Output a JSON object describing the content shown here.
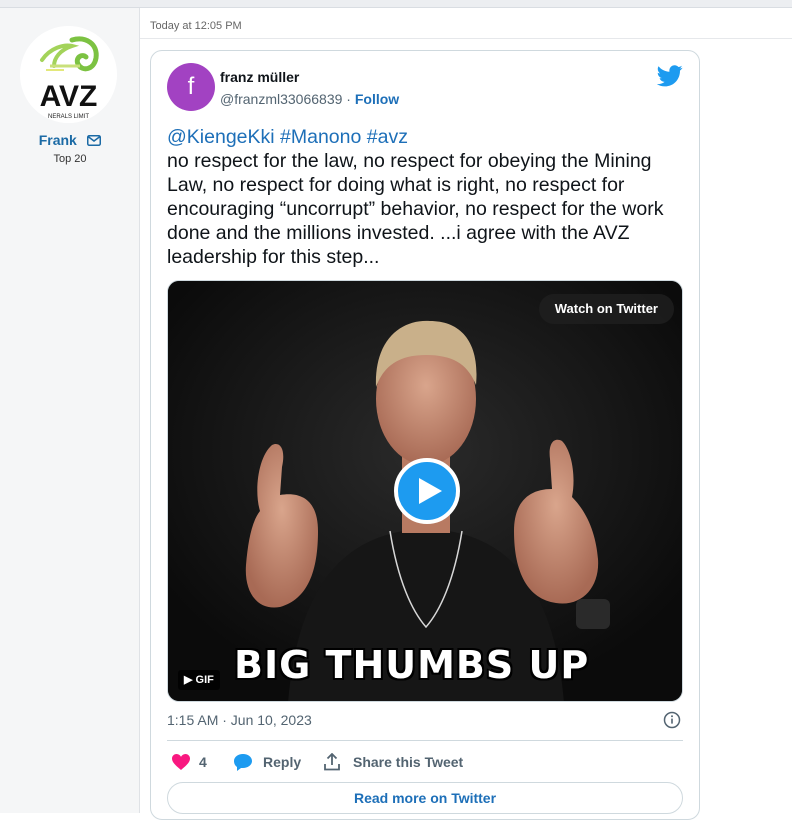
{
  "sidebar": {
    "logo_text": "AVZ",
    "logo_subtext": "NERALS LIMIT",
    "username": "Frank",
    "rank": "Top 20",
    "icons": {
      "message": "mail-icon"
    }
  },
  "post": {
    "timestamp": "Today at 12:05 PM"
  },
  "tweet": {
    "avatar_letter": "f",
    "avatar_color": "#a242c2",
    "display_name": "franz müller",
    "handle": "@franzml33066839",
    "separator": " · ",
    "follow_label": "Follow",
    "tags": "@KiengeKki #Manono #avz",
    "body": "no respect for the law, no respect for obeying the Mining Law, no respect for doing what is right, no respect for encouraging “uncorrupt” behavior, no respect for the work done and the millions invested. ...i agree with the AVZ leadership for this step...",
    "media": {
      "watch_label": "Watch on Twitter",
      "badge_label": "GIF",
      "caption": "BIG THUMBS UP"
    },
    "date": "1:15 AM · Jun 10, 2023",
    "likes": "4",
    "reply_label": "Reply",
    "share_label": "Share this Tweet",
    "read_more_label": "Read more on Twitter",
    "colors": {
      "link": "#1d6fb8",
      "like": "#f91880",
      "play": "#1d9bf0"
    }
  }
}
